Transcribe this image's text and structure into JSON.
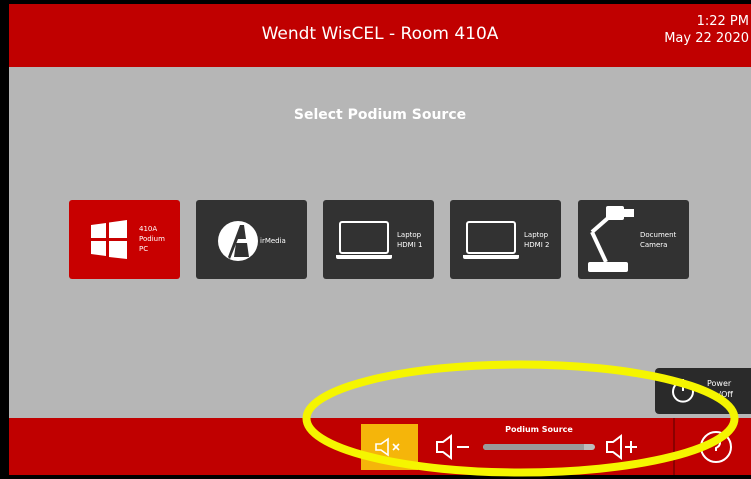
{
  "header": {
    "title": "Wendt WisCEL - Room 410A",
    "time": "1:22 PM",
    "date": "May 22 2020"
  },
  "main": {
    "prompt": "Select Podium Source"
  },
  "sources": [
    {
      "name": "windows-icon",
      "line1": "410A",
      "line2": "Podium",
      "line3": "PC",
      "active": true
    },
    {
      "name": "airmedia-icon",
      "line1": "irMedia",
      "line2": "",
      "line3": "",
      "active": false
    },
    {
      "name": "laptop-icon",
      "line1": "Laptop",
      "line2": "HDMI 1",
      "line3": "",
      "active": false
    },
    {
      "name": "laptop-icon",
      "line1": "Laptop",
      "line2": "HDMI 2",
      "line3": "",
      "active": false
    },
    {
      "name": "document-camera-icon",
      "line1": "Document",
      "line2": "Camera",
      "line3": "",
      "active": false
    }
  ],
  "power": {
    "line1": "Power",
    "line2": "On/Off"
  },
  "volume": {
    "label": "Podium Source",
    "level_percent": 90,
    "muted": true
  },
  "colors": {
    "brand_red": "#c00000",
    "mute_yellow": "#f5b50a",
    "highlight_ellipse": "#f5f500",
    "button_dark": "#323232"
  }
}
